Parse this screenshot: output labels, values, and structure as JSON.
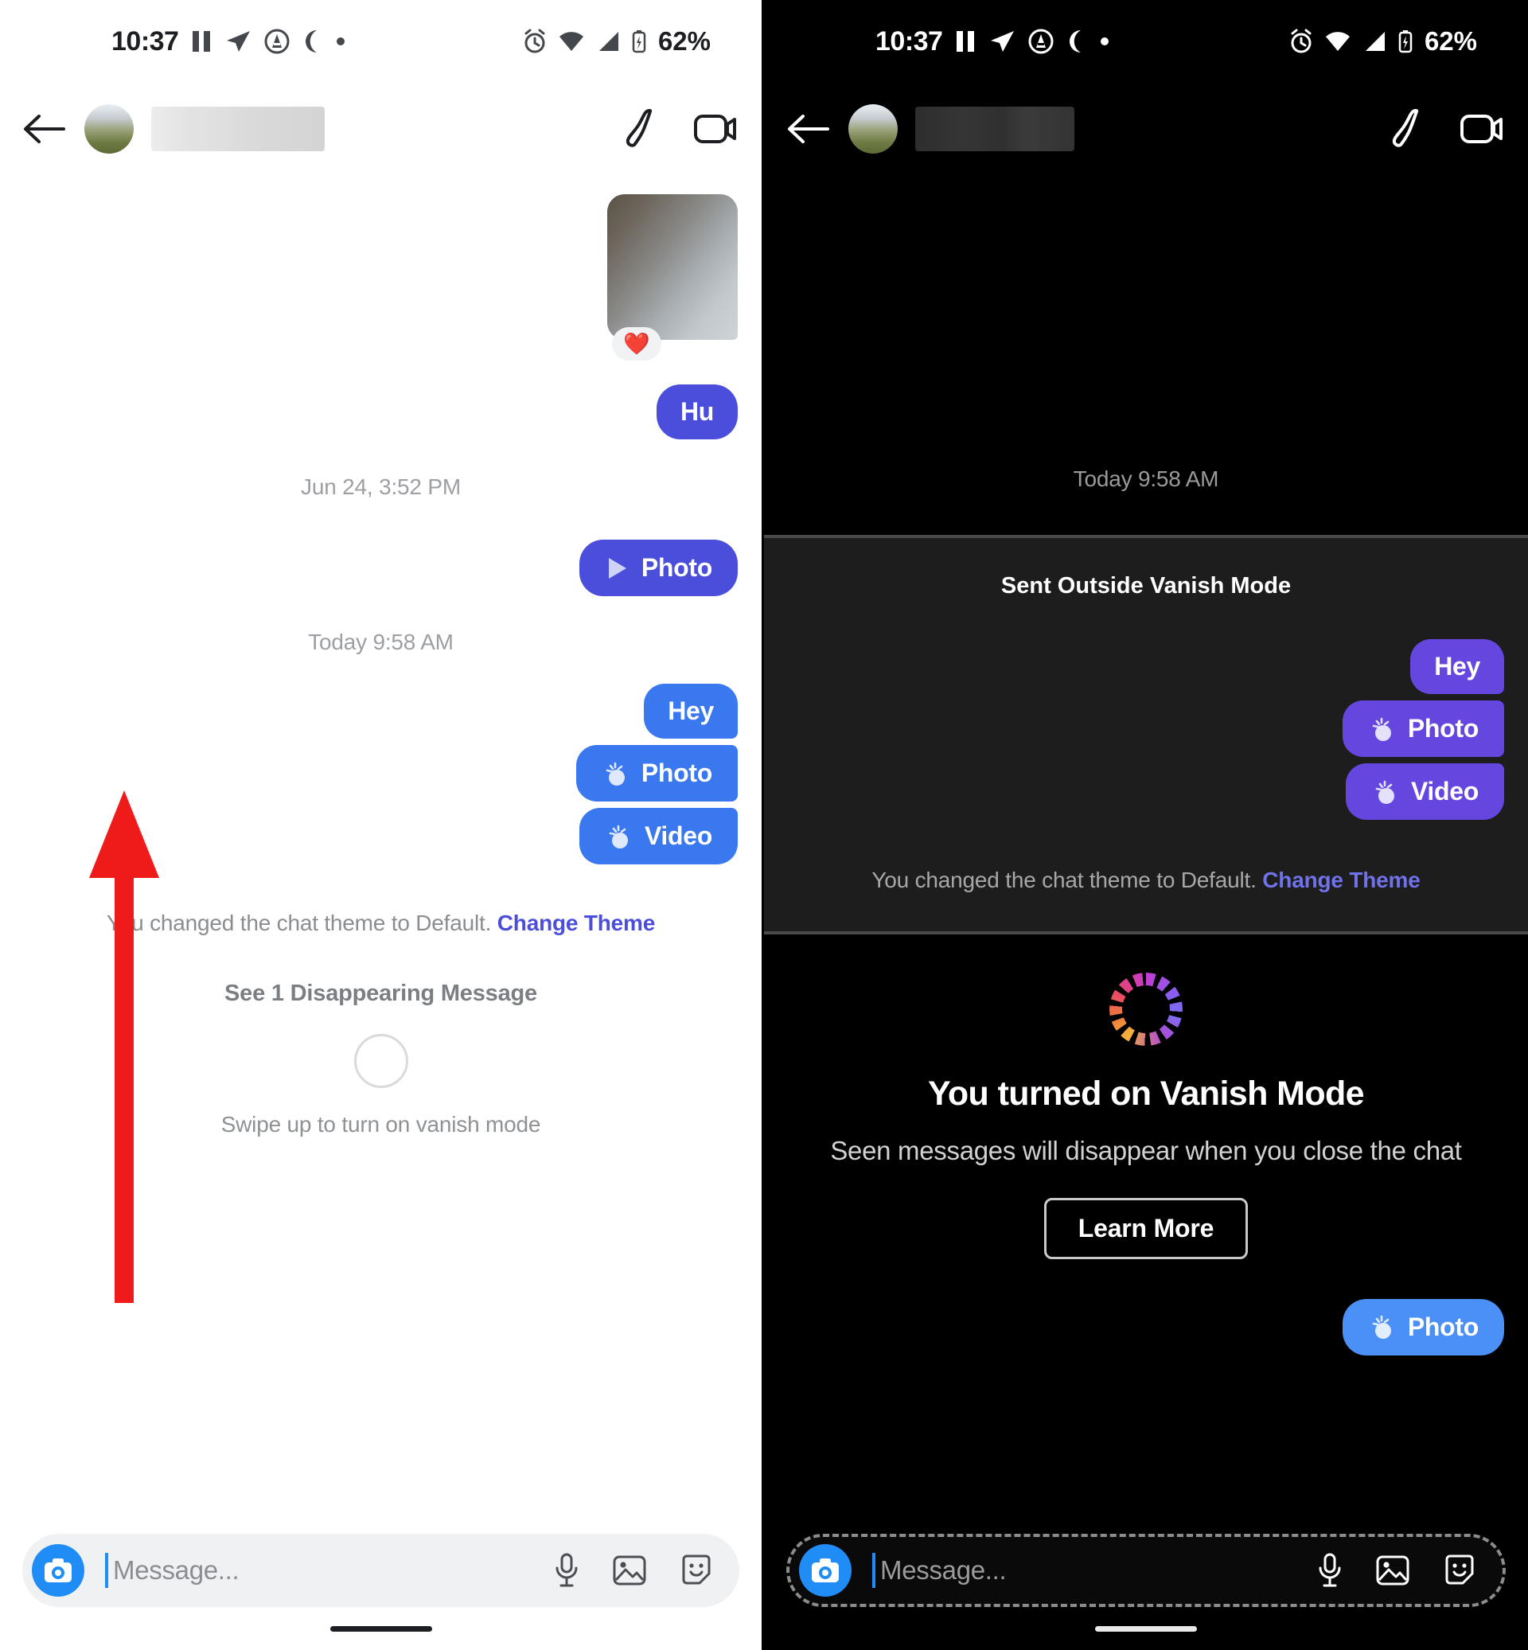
{
  "meta": {
    "app": "Messenger",
    "panels": [
      "light",
      "dark"
    ]
  },
  "status_bar": {
    "time": "10:37",
    "battery_text": "62%",
    "left_icons": [
      "pause-icon",
      "send-icon",
      "android-auto-icon",
      "crescent-moon-icon",
      "dot-icon"
    ],
    "right_icons": [
      "alarm-clock-icon",
      "wifi-icon",
      "cellular-signal-icon",
      "battery-icon"
    ]
  },
  "chat_header": {
    "back_label": "Back",
    "contact_name_redacted": "",
    "actions": [
      "audio-call-icon",
      "video-call-icon"
    ]
  },
  "light_panel": {
    "photo_attachment": {
      "reaction_emoji": "❤️",
      "alt": "photo-attachment"
    },
    "bubbles_top": [
      {
        "label": "Hu",
        "style": "purple",
        "icon": null
      }
    ],
    "timestamp_1": "Jun 24, 3:52 PM",
    "bubbles_mid": [
      {
        "label": "Photo",
        "style": "purple",
        "icon": "play-icon"
      }
    ],
    "timestamp_2": "Today 9:58 AM",
    "bubbles_bottom": [
      {
        "label": "Hey",
        "style": "blue",
        "icon": null
      },
      {
        "label": "Photo",
        "style": "blue",
        "icon": "bomb-timer-icon"
      },
      {
        "label": "Video",
        "style": "blue",
        "icon": "bomb-timer-icon"
      }
    ],
    "theme_note": "You changed the chat theme to Default.",
    "theme_link": "Change Theme",
    "disappearing_title": "See 1 Disappearing Message",
    "swipe_hint": "Swipe up to turn on vanish mode",
    "composer": {
      "placeholder": "Message...",
      "icons": [
        "camera-icon",
        "microphone-icon",
        "gallery-icon",
        "sticker-icon"
      ]
    },
    "annotation": {
      "type": "red-arrow",
      "direction": "up",
      "color": "#ef1a1a",
      "meaning": "swipe up gesture"
    }
  },
  "dark_panel": {
    "timestamp_1": "Today 9:58 AM",
    "sent_outside_label": "Sent Outside Vanish Mode",
    "bubbles": [
      {
        "label": "Hey",
        "style": "purple",
        "icon": null
      },
      {
        "label": "Photo",
        "style": "purple",
        "icon": "bomb-timer-icon"
      },
      {
        "label": "Video",
        "style": "purple",
        "icon": "bomb-timer-icon"
      }
    ],
    "theme_note": "You changed the chat theme to Default.",
    "theme_link": "Change Theme",
    "vanish": {
      "ring_icon": "vanish-mode-dashed-ring-icon",
      "title": "You turned on Vanish Mode",
      "subtitle": "Seen messages will disappear when you close the chat",
      "button": "Learn More"
    },
    "bubble_after": {
      "label": "Photo",
      "style": "blue",
      "icon": "bomb-timer-icon"
    },
    "composer": {
      "placeholder": "Message...",
      "icons": [
        "camera-icon",
        "microphone-icon",
        "gallery-icon",
        "sticker-icon"
      ]
    }
  },
  "colors": {
    "accent_blue": "#3a78ef",
    "accent_purple": "#4b4ddb",
    "camera_blue": "#1f8df5",
    "annotation_red": "#ef1a1a",
    "link_blue": "#4b4ddb"
  }
}
